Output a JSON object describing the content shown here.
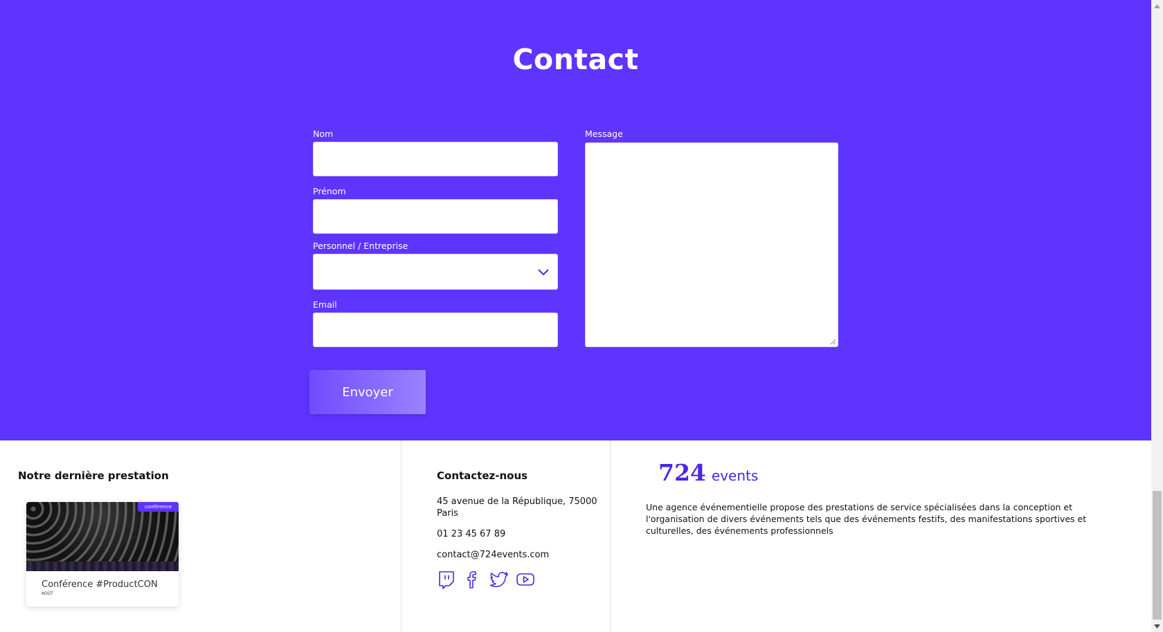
{
  "contact": {
    "title": "Contact",
    "fields": {
      "nom_label": "Nom",
      "prenom_label": "Prénom",
      "type_label": "Personnel / Entreprise",
      "email_label": "Email",
      "message_label": "Message"
    },
    "submit_label": "Envoyer"
  },
  "footer": {
    "latest": {
      "heading": "Notre dernière prestation",
      "card": {
        "badge": "conférence",
        "title": "Conférence #ProductCON",
        "date": "AOÛT"
      }
    },
    "contact_us": {
      "heading": "Contactez-nous",
      "address_line1": "45 avenue de la République, 75000",
      "address_line2": "Paris",
      "phone": "01 23 45 67 89",
      "email": "contact@724events.com",
      "social_icons": [
        "twitch-icon",
        "facebook-icon",
        "twitter-icon",
        "youtube-icon"
      ]
    },
    "brand": {
      "number": "724",
      "word": "events",
      "description": "Une agence événementielle propose des prestations de service spécialisées dans la conception et l'organisation de divers événements tels que des événements festifs, des manifestations sportives et culturelles, des événements professionnels"
    }
  },
  "colors": {
    "primary": "#5f34ff",
    "brand_text": "#4a26e8",
    "white": "#ffffff"
  }
}
